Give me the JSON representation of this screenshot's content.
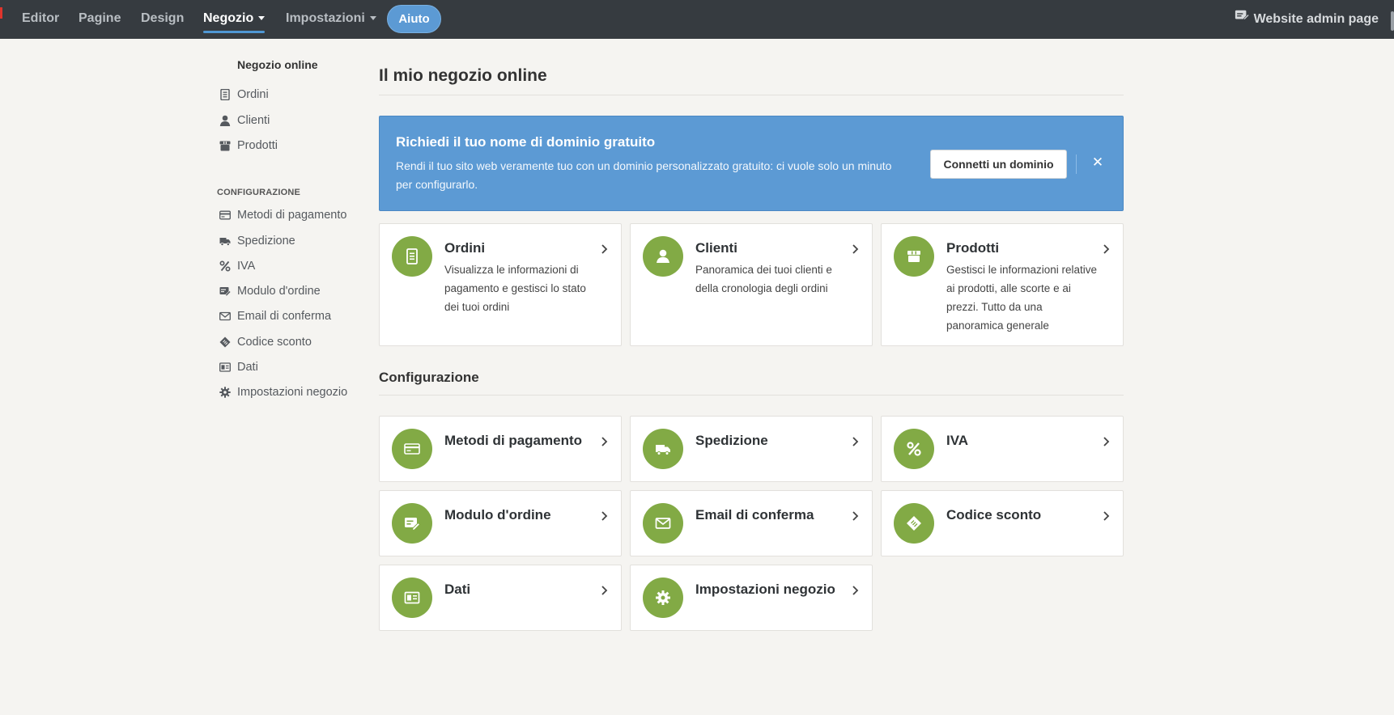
{
  "topnav": {
    "items": [
      {
        "label": "Editor"
      },
      {
        "label": "Pagine"
      },
      {
        "label": "Design"
      },
      {
        "label": "Negozio"
      },
      {
        "label": "Impostazioni"
      }
    ],
    "help": "Aiuto",
    "admin_link": "Website admin page",
    "active_item": "Negozio"
  },
  "sidebar": {
    "title": "Negozio online",
    "items": [
      {
        "label": "Ordini",
        "icon": "orders-icon"
      },
      {
        "label": "Clienti",
        "icon": "user-icon"
      },
      {
        "label": "Prodotti",
        "icon": "box-icon"
      }
    ],
    "section": "CONFIGURAZIONE",
    "config_items": [
      {
        "label": "Metodi di pagamento",
        "icon": "credit-card-icon"
      },
      {
        "label": "Spedizione",
        "icon": "truck-icon"
      },
      {
        "label": "IVA",
        "icon": "percent-icon"
      },
      {
        "label": "Modulo d'ordine",
        "icon": "form-edit-icon"
      },
      {
        "label": "Email di conferma",
        "icon": "envelope-icon"
      },
      {
        "label": "Codice sconto",
        "icon": "ticket-icon"
      },
      {
        "label": "Dati",
        "icon": "id-card-icon"
      },
      {
        "label": "Impostazioni negozio",
        "icon": "gear-icon"
      }
    ]
  },
  "main": {
    "title": "Il mio negozio online",
    "banner": {
      "title": "Richiedi il tuo nome di dominio gratuito",
      "text": "Rendi il tuo sito web veramente tuo con un dominio personalizzato gratuito: ci vuole solo un minuto per configurarlo.",
      "button": "Connetti un dominio",
      "close": "✕"
    },
    "cards": [
      {
        "title": "Ordini",
        "desc": "Visualizza le informazioni di pagamento e gestisci lo stato dei tuoi ordini"
      },
      {
        "title": "Clienti",
        "desc": "Panoramica dei tuoi clienti e della cronologia degli ordini"
      },
      {
        "title": "Prodotti",
        "desc": "Gestisci le informazioni relative ai prodotti, alle scorte e ai prezzi. Tutto da una panoramica generale"
      }
    ],
    "config_title": "Configurazione",
    "config_cards": [
      {
        "title": "Metodi di pagamento"
      },
      {
        "title": "Spedizione"
      },
      {
        "title": "IVA"
      },
      {
        "title": "Modulo d'ordine"
      },
      {
        "title": "Email di conferma"
      },
      {
        "title": "Codice sconto"
      },
      {
        "title": "Dati"
      },
      {
        "title": "Impostazioni negozio"
      }
    ]
  },
  "colors": {
    "topbar": "#363b40",
    "accent_blue": "#5c9ad4",
    "icon_green": "#82aa45",
    "page_bg": "#f5f4f1"
  }
}
